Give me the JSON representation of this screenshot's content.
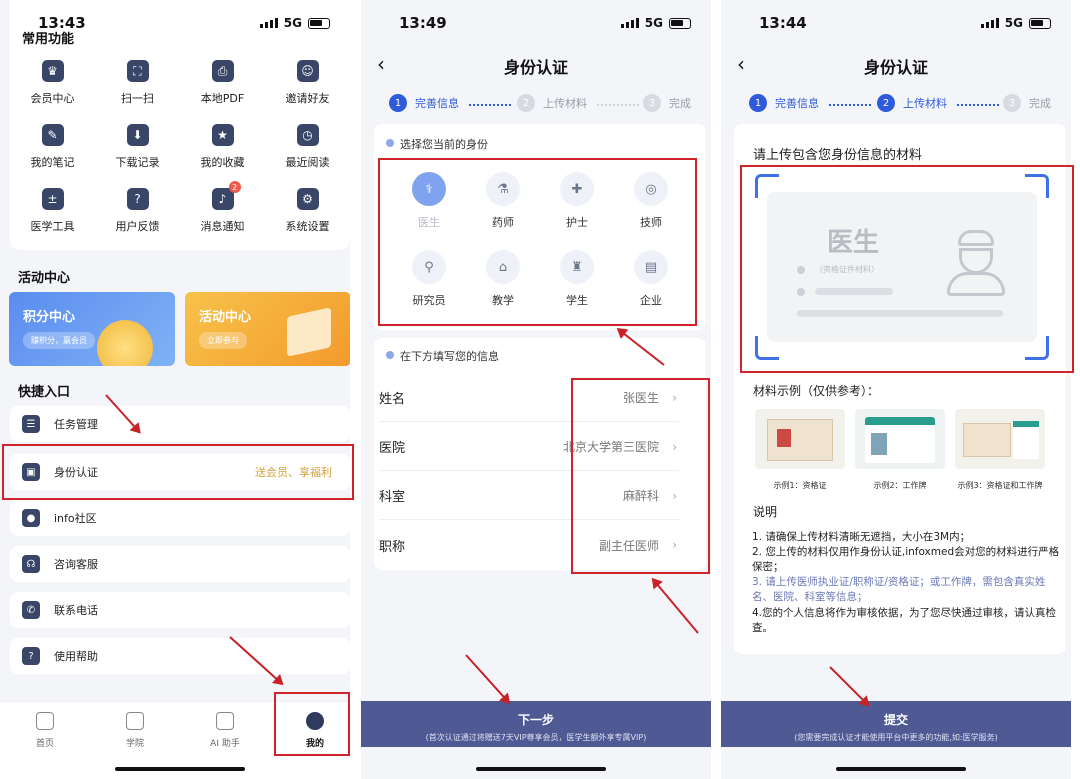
{
  "phone1": {
    "time": "13:43",
    "network": "5G",
    "common_title": "常用功能",
    "functions": [
      {
        "label": "会员中心",
        "icon": "crown-icon",
        "glyph": "♛"
      },
      {
        "label": "扫一扫",
        "icon": "scan-icon",
        "glyph": "⛶"
      },
      {
        "label": "本地PDF",
        "icon": "pdf-icon",
        "glyph": "⎙"
      },
      {
        "label": "邀请好友",
        "icon": "invite-icon",
        "glyph": "☺"
      },
      {
        "label": "我的笔记",
        "icon": "note-icon",
        "glyph": "✎"
      },
      {
        "label": "下载记录",
        "icon": "download-icon",
        "glyph": "⬇"
      },
      {
        "label": "我的收藏",
        "icon": "favorite-icon",
        "glyph": "★"
      },
      {
        "label": "最近阅读",
        "icon": "recent-icon",
        "glyph": "◷"
      },
      {
        "label": "医学工具",
        "icon": "calculator-icon",
        "glyph": "±"
      },
      {
        "label": "用户反馈",
        "icon": "feedback-icon",
        "glyph": "?"
      },
      {
        "label": "消息通知",
        "icon": "bell-icon",
        "glyph": "♪",
        "badge": "2"
      },
      {
        "label": "系统设置",
        "icon": "settings-icon",
        "glyph": "⚙"
      }
    ],
    "activity_title": "活动中心",
    "banners": [
      {
        "title": "积分中心",
        "sub": "赚积分，赢会员"
      },
      {
        "title": "活动中心",
        "sub": "立即参与"
      }
    ],
    "quick_title": "快捷入口",
    "quick": [
      {
        "label": "任务管理",
        "icon": "task-icon",
        "glyph": "☰",
        "promo": ""
      },
      {
        "label": "身份认证",
        "icon": "id-card-icon",
        "glyph": "▣",
        "promo": "送会员、享福利"
      },
      {
        "label": "info社区",
        "icon": "community-icon",
        "glyph": "●",
        "promo": ""
      },
      {
        "label": "咨询客服",
        "icon": "headset-icon",
        "glyph": "☊",
        "promo": ""
      },
      {
        "label": "联系电话",
        "icon": "phone-icon",
        "glyph": "✆",
        "promo": ""
      },
      {
        "label": "使用帮助",
        "icon": "help-icon",
        "glyph": "?",
        "promo": ""
      }
    ],
    "tabs": [
      {
        "label": "首页",
        "icon": "home-icon"
      },
      {
        "label": "学院",
        "icon": "book-icon"
      },
      {
        "label": "AI 助手",
        "icon": "robot-icon"
      },
      {
        "label": "我的",
        "icon": "user-icon"
      }
    ]
  },
  "phone2": {
    "time": "13:49",
    "network": "5G",
    "title": "身份认证",
    "steps": [
      {
        "num": "1",
        "label": "完善信息"
      },
      {
        "num": "2",
        "label": "上传材料"
      },
      {
        "num": "3",
        "label": "完成"
      }
    ],
    "select_title": "选择您当前的身份",
    "identities": [
      {
        "label": "医生",
        "icon": "doctor-icon",
        "glyph": "⚕"
      },
      {
        "label": "药师",
        "icon": "pharmacist-icon",
        "glyph": "⚗"
      },
      {
        "label": "护士",
        "icon": "nurse-icon",
        "glyph": "✚"
      },
      {
        "label": "技师",
        "icon": "technician-icon",
        "glyph": "◎"
      },
      {
        "label": "研究员",
        "icon": "microscope-icon",
        "glyph": "⚲"
      },
      {
        "label": "教学",
        "icon": "teaching-icon",
        "glyph": "⌂"
      },
      {
        "label": "学生",
        "icon": "graduation-cap-icon",
        "glyph": "♜"
      },
      {
        "label": "企业",
        "icon": "building-icon",
        "glyph": "▤"
      }
    ],
    "fill_title": "在下方填写您的信息",
    "fields": [
      {
        "label": "姓名",
        "value": "张医生"
      },
      {
        "label": "医院",
        "value": "北京大学第三医院"
      },
      {
        "label": "科室",
        "value": "麻醉科"
      },
      {
        "label": "职称",
        "value": "副主任医师"
      }
    ],
    "button_label": "下一步",
    "button_sub": "(首次认证通过将赠送7天VIP尊享会员，医学生额外享专属VIP)"
  },
  "phone3": {
    "time": "13:44",
    "network": "5G",
    "title": "身份认证",
    "steps": [
      {
        "num": "1",
        "label": "完善信息"
      },
      {
        "num": "2",
        "label": "上传材料"
      },
      {
        "num": "3",
        "label": "完成"
      }
    ],
    "upload_title": "请上传包含您身份信息的材料",
    "card_title": "医生",
    "card_sub": "（资格证件材料）",
    "examples_title": "材料示例（仅供参考）：",
    "examples": [
      {
        "label": "示例1：资格证"
      },
      {
        "label": "示例2：工作牌"
      },
      {
        "label": "示例3：资格证和工作牌"
      }
    ],
    "notes_title": "说明",
    "notes": [
      "1. 请确保上传材料清晰无遮挡，大小在3M内；",
      "2. 您上传的材料仅用作身份认证,infoxmed会对您的材料进行严格保密；",
      "3. 请上传医师执业证/职称证/资格证；或工作牌，需包含真实姓名、医院、科室等信息；",
      "4.您的个人信息将作为审核依据，为了您尽快通过审核，请认真检查。"
    ],
    "button_label": "提交",
    "button_sub": "(您需要完成认证才能使用平台中更多的功能,如:医学服务)"
  },
  "colors": {
    "accent": "#2e5bdc",
    "bottom_button": "#4f5994",
    "highlight": "#d2232a",
    "promo": "#d4a23a"
  }
}
